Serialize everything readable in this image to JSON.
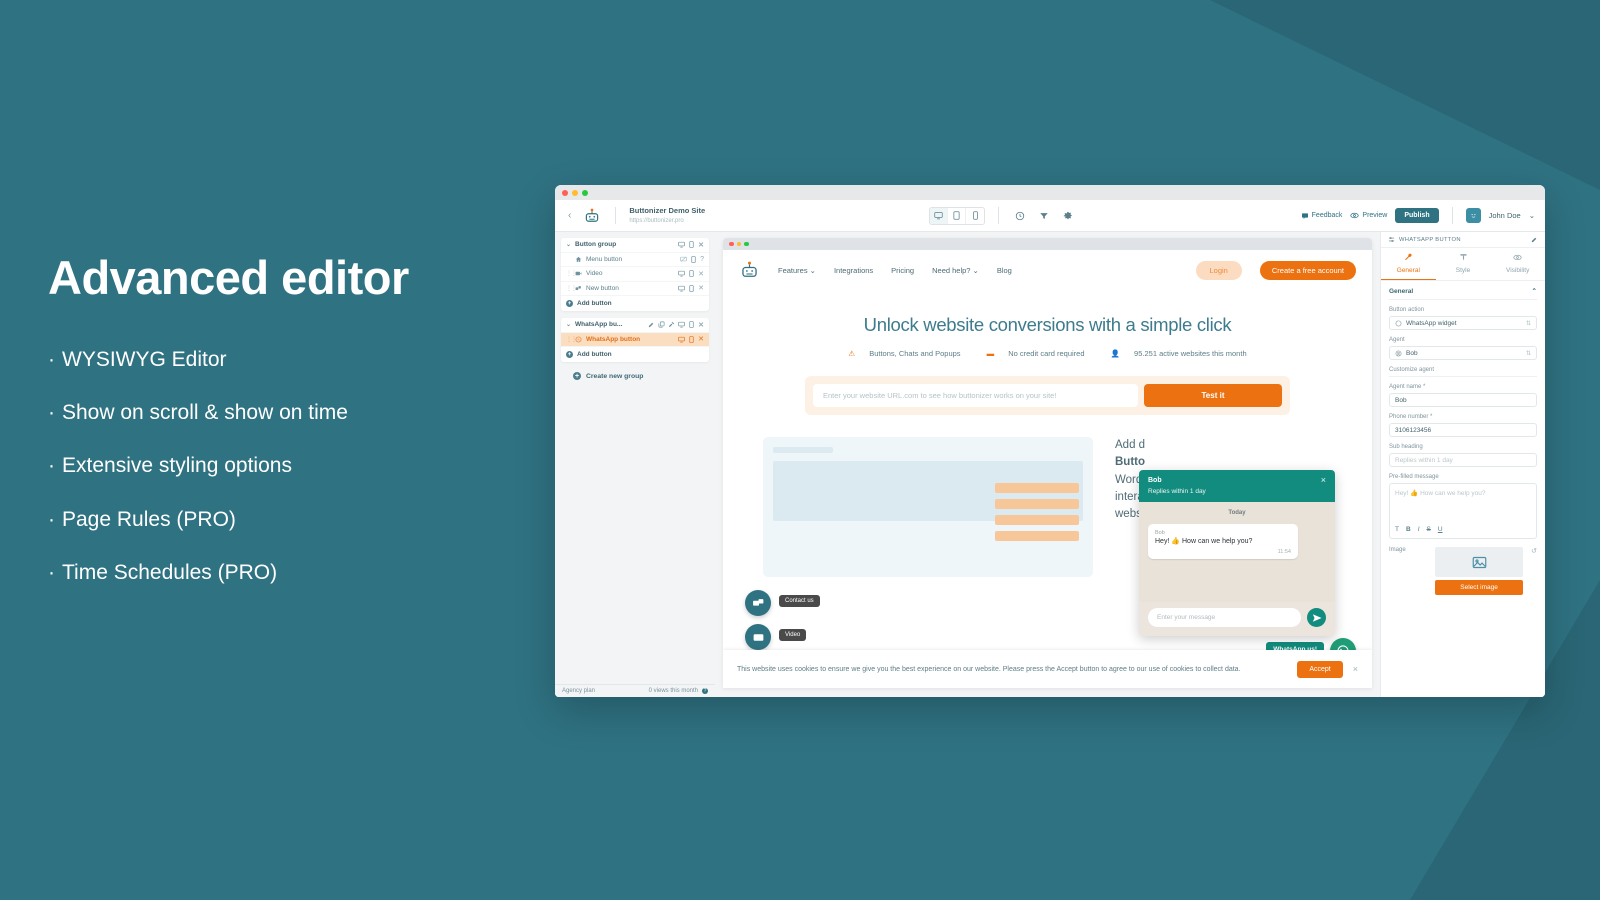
{
  "theme": {
    "bg": "#2f7282",
    "bg_dark": "#2a6675",
    "accent_orange": "#ec7211",
    "teal": "#2f7282",
    "whatsapp_green": "#128c7e"
  },
  "marketing": {
    "headline": "Advanced editor",
    "bullets": [
      "WYSIWYG Editor",
      "Show on scroll & show on time",
      "Extensive styling options",
      "Page Rules (PRO)",
      "Time Schedules (PRO)"
    ],
    "bullet_mark": "·"
  },
  "toolbar": {
    "back_icon": "chevron-left-icon",
    "logo_icon": "buttonizer-robot-logo",
    "site_name": "Buttonizer Demo Site",
    "site_url": "https://buttonizer.pro",
    "devices": [
      {
        "name": "desktop-view",
        "icon": "desktop-icon",
        "active": true
      },
      {
        "name": "tablet-view",
        "icon": "tablet-icon",
        "active": false
      },
      {
        "name": "mobile-view",
        "icon": "mobile-icon",
        "active": false
      }
    ],
    "tools": [
      {
        "name": "history-icon",
        "label": "History"
      },
      {
        "name": "filter-icon",
        "label": "Filter"
      },
      {
        "name": "gear-icon",
        "label": "Settings"
      }
    ],
    "feedback_label": "Feedback",
    "preview_label": "Preview",
    "publish_label": "Publish",
    "user_name": "John Doe",
    "user_caret": "⌄"
  },
  "layers": {
    "groups": [
      {
        "header": {
          "label": "Button group",
          "icons": [
            "desktop-icon",
            "mobile-icon",
            "close-icon"
          ]
        },
        "rows": [
          {
            "label": "Menu button",
            "icon": "home-icon",
            "icons": [
              "desktop-off-icon",
              "mobile-icon",
              "help-icon"
            ],
            "selected": false,
            "drag": false
          },
          {
            "label": "Video",
            "icon": "video-icon",
            "icons": [
              "desktop-icon",
              "mobile-icon",
              "close-icon"
            ],
            "selected": false,
            "drag": true
          },
          {
            "label": "New button",
            "icon": "share-icon",
            "icons": [
              "desktop-icon",
              "mobile-icon",
              "close-icon"
            ],
            "selected": false,
            "drag": true
          }
        ],
        "add_label": "Add button"
      },
      {
        "header": {
          "label": "WhatsApp bu...",
          "icons": [
            "edit-icon",
            "duplicate-icon",
            "tools-icon",
            "desktop-icon",
            "mobile-icon",
            "close-icon"
          ]
        },
        "rows": [
          {
            "label": "WhatsApp button",
            "icon": "whatsapp-icon",
            "icons": [
              "desktop-icon",
              "mobile-icon",
              "close-icon"
            ],
            "selected": true,
            "drag": true
          }
        ],
        "add_label": "Add button"
      }
    ],
    "create_group_label": "Create new group",
    "plan_label": "Agency plan",
    "views_label": "0 views this month"
  },
  "site": {
    "nav_links": [
      "Features ⌄",
      "Integrations",
      "Pricing",
      "Need help? ⌄",
      "Blog"
    ],
    "login_label": "Login",
    "cta_label": "Create a free account",
    "hero_title": "Unlock website conversions with a simple click",
    "hero_features": [
      {
        "icon": "buttons-icon",
        "text": "Buttons, Chats and Popups"
      },
      {
        "icon": "card-icon",
        "text": "No credit card required"
      },
      {
        "icon": "users-icon",
        "text": "95.251 active websites this month"
      }
    ],
    "url_placeholder": "Enter your website URL.com to see how buttonizer works on your site!",
    "test_label": "Test it",
    "lower_text_1": "Add d",
    "lower_text_2": "Butto",
    "lower_text_3": "WordP",
    "lower_text_4": "interac",
    "lower_text_5": "websit",
    "cookie_text": "This website uses cookies to ensure we give you the best experience on our website. Please press the Accept button to agree to our use of cookies to collect data.",
    "cookie_accept": "Accept",
    "cookie_close": "×"
  },
  "widgets": {
    "contact_label": "Contact us",
    "video_label": "Video",
    "whatsapp_label": "WhatsApp us!",
    "contact_icon": "contact-us-icon",
    "video_icon": "video-play-icon",
    "whatsapp_icon": "whatsapp-icon"
  },
  "chat": {
    "agent_name": "Bob",
    "agent_sub": "Replies within 1 day",
    "close": "×",
    "today_label": "Today",
    "message_sender": "Bob",
    "message_text": "Hey! 👍 How can we help you?",
    "message_time": "11:54",
    "input_placeholder": "Enter your message",
    "send_icon": "send-icon"
  },
  "properties": {
    "panel_title": "WHATSAPP BUTTON",
    "panel_icon": "sliders-icon",
    "edit_icon": "pencil-icon",
    "tabs": [
      {
        "label": "General",
        "icon": "wrench-icon",
        "active": true
      },
      {
        "label": "Style",
        "icon": "brush-icon",
        "active": false
      },
      {
        "label": "Visibility",
        "icon": "eye-icon",
        "active": false
      }
    ],
    "section_title": "General",
    "section_collapse": "⌃",
    "fields": [
      {
        "label": "Button action",
        "value": "WhatsApp widget",
        "icon": "whatsapp-icon",
        "type": "select",
        "placeholder": false
      },
      {
        "label": "Agent",
        "value": "Bob",
        "icon": "user-circle-icon",
        "type": "select",
        "placeholder": false
      }
    ],
    "customize_label": "Customize agent",
    "agent_name_label": "Agent name *",
    "agent_name_value": "Bob",
    "phone_label": "Phone number *",
    "phone_value": "3106123456",
    "sub_heading_label": "Sub heading",
    "sub_heading_placeholder": "Replies within 1 day",
    "prefilled_label": "Pre-filled message",
    "prefilled_placeholder": "Hey! 👍 How can we help you?",
    "format_tools": [
      "T",
      "B",
      "I",
      "S",
      "U"
    ],
    "image_label": "Image",
    "image_icon": "image-placeholder-icon",
    "select_image_label": "Select image",
    "reset_icon": "reset-icon"
  }
}
